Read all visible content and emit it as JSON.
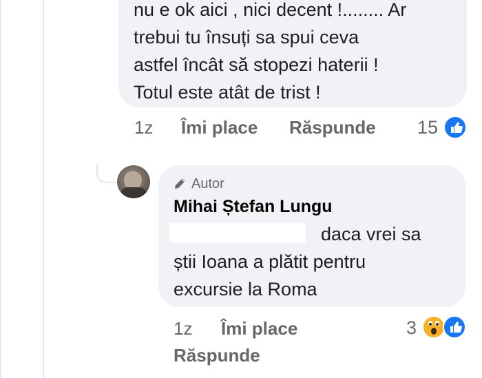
{
  "comment1": {
    "text_lines": [
      "nu e ok aici , nici decent !........ Ar",
      "trebui tu însuți sa spui ceva",
      "astfel încât să stopezi haterii !",
      "Totul este atât de trist !"
    ],
    "actions": {
      "time": "1z",
      "like": "Îmi place",
      "reply": "Răspunde"
    },
    "reaction_count": "15",
    "reactions": [
      "like-icon"
    ]
  },
  "comment2": {
    "badge": "Autor",
    "author": "Mihai Ștefan Lungu",
    "text_lines": [
      "daca vrei sa",
      "știi Ioana a plătit pentru",
      "excursie la Roma"
    ],
    "actions": {
      "time": "1z",
      "like": "Îmi place",
      "reply": "Răspunde"
    },
    "reaction_count": "3",
    "reactions": [
      "wow-icon",
      "like-icon"
    ]
  },
  "colors": {
    "bubble": "#f0f2f5",
    "meta": "#65676b",
    "like": "#1877f2",
    "wow": "#f7b125"
  }
}
